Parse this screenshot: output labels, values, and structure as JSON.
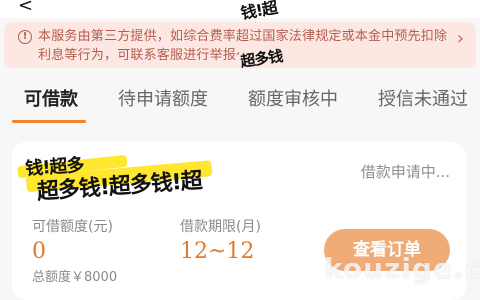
{
  "header": {
    "back_symbol": "<",
    "top_stamp": "钱!超"
  },
  "notice": {
    "icon_name": "info-circle-icon",
    "text": "本服务由第三方提供，如综合费率超过国家法律规定或本金中预先扣除利息等行为，可联系客服进行举报～",
    "hidden_overlay_text": "超多钱"
  },
  "tabs": [
    {
      "label": "可借款",
      "active": true
    },
    {
      "label": "待申请额度",
      "active": false
    },
    {
      "label": "额度审核中",
      "active": false
    },
    {
      "label": "授信未通过",
      "active": false
    }
  ],
  "card": {
    "status": "借款申请中...",
    "stamp_line_1": "钱!超多",
    "stamp_line_2": "超多钱!超多钱!超",
    "credit_label": "可借额度(元)",
    "credit_value": "0",
    "term_label": "借款期限(月)",
    "term_value": "12~12",
    "total_limit": "总额度￥8000",
    "order_button": "查看订单"
  },
  "watermark": "kouzige.c",
  "colors": {
    "accent_orange": "#f0832b",
    "value_orange": "#e07b2b",
    "button_orange": "#f0ac77",
    "notice_bg": "#fde7e2",
    "notice_text": "#b45d4e",
    "highlight_yellow": "#ffe62f"
  }
}
